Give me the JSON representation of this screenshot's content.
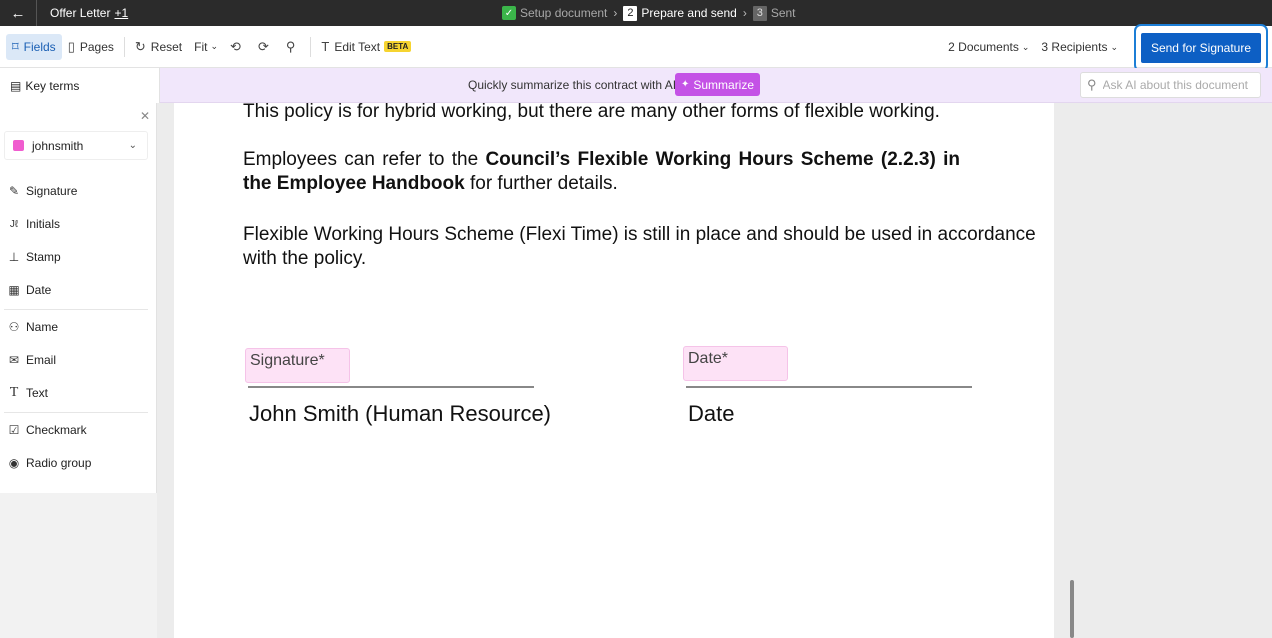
{
  "topbar": {
    "back_icon": "arrow-left-icon",
    "doc_title": "Offer Letter",
    "doc_extra": "+1",
    "steps": [
      {
        "marker": "✓",
        "label": "Setup document",
        "state": "done"
      },
      {
        "marker": "2",
        "label": "Prepare and send",
        "state": "current"
      },
      {
        "marker": "3",
        "label": "Sent",
        "state": "pending"
      }
    ]
  },
  "toolbar": {
    "fields_label": "Fields",
    "pages_label": "Pages",
    "reset_label": "Reset",
    "fit_label": "Fit",
    "edit_text_label": "Edit Text",
    "beta_badge": "BETA",
    "documents_label": "2 Documents",
    "recipients_label": "3 Recipients",
    "send_label": "Send for Signature"
  },
  "aibar": {
    "key_terms_label": "Key terms",
    "prompt_text": "Quickly summarize this contract with AI",
    "summarize_label": "Summarize",
    "ask_placeholder": "Ask AI about this document"
  },
  "leftpanel": {
    "recipient": {
      "name": "johnsmith",
      "color": "#f05ccf"
    },
    "fields": [
      {
        "label": "Signature",
        "icon": "pen-icon"
      },
      {
        "label": "Initials",
        "icon": "initials-icon"
      },
      {
        "label": "Stamp",
        "icon": "stamp-icon"
      },
      {
        "label": "Date",
        "icon": "calendar-icon"
      },
      {
        "label": "Name",
        "icon": "person-icon"
      },
      {
        "label": "Email",
        "icon": "mail-icon"
      },
      {
        "label": "Text",
        "icon": "text-icon"
      },
      {
        "label": "Checkmark",
        "icon": "checkbox-icon"
      },
      {
        "label": "Radio group",
        "icon": "radio-icon"
      }
    ]
  },
  "document": {
    "para1": "This policy is for hybrid working, but there are many other forms of flexible working.",
    "para2_start": "Employees can refer to the ",
    "para2_bold1": "Council’s Flexible Working Hours Scheme (2.2.3) in the",
    "para2_bold2": "Employee Handbook",
    "para2_end": " for further details.",
    "para3_line1": "Flexible Working Hours Scheme (Flexi Time) is still in place and should be used in accordance",
    "para3_line2": "with the policy.",
    "signature_field": "Signature*",
    "date_field": "Date*",
    "signer_name": "John Smith (Human Resource)",
    "date_label": "Date"
  },
  "colors": {
    "accent": "#0d5fc4",
    "summarize": "#c452e6",
    "field_bg": "#fde2f6"
  }
}
